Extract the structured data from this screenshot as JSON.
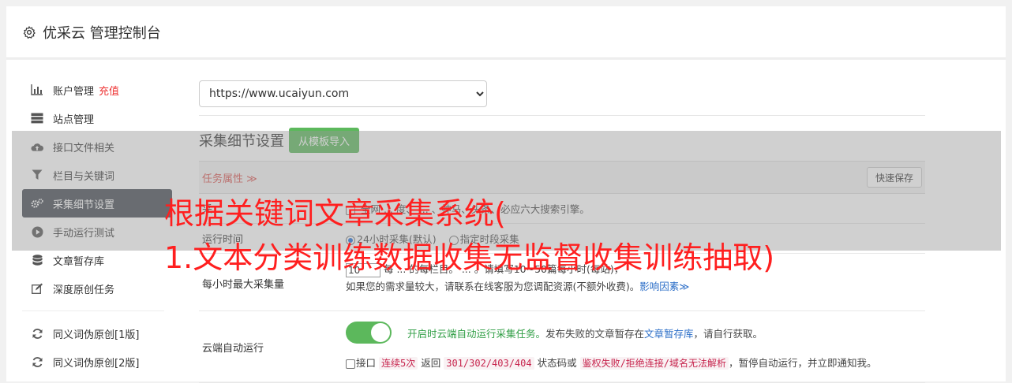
{
  "header": {
    "title": "优采云 管理控制台",
    "icon": "gear-icon"
  },
  "sidebar": {
    "items": [
      {
        "label": "账户管理",
        "badge": "充值",
        "icon": "bar-chart-icon"
      },
      {
        "label": "站点管理",
        "icon": "server-icon"
      },
      {
        "label": "接口文件相关",
        "icon": "cloud-upload-icon"
      },
      {
        "label": "栏目与关键词",
        "icon": "filter-icon"
      },
      {
        "label": "采集细节设置",
        "icon": "gears-icon",
        "active": true
      },
      {
        "label": "手动运行测试",
        "icon": "play-icon"
      },
      {
        "label": "文章暂存库",
        "icon": "database-icon"
      },
      {
        "label": "深度原创任务",
        "icon": "edit-icon"
      },
      {
        "label": "同义词伪原创[1版]",
        "icon": "refresh-icon"
      },
      {
        "label": "同义词伪原创[2版]",
        "icon": "refresh-icon"
      }
    ]
  },
  "site_select": {
    "value": "https://www.ucaiyun.com"
  },
  "section": {
    "title": "采集细节设置",
    "import_button": "从模板导入"
  },
  "panel": {
    "task_label": "任务属性 ≫",
    "save_button": "快速保存",
    "source_row": {
      "label": "采",
      "text": "全网  ...  度、  ...  、神马、头条、必应六大搜索引擎。"
    },
    "runtime_row": {
      "label": "运行时间",
      "option1": "24小时采集(默认)",
      "option2": "指定时段采集"
    },
    "max_row": {
      "label": "每小时最大采集量",
      "value": "10",
      "text1": "每  ...  的每栏目。  ...  。请填写10~50篇每小时(每站)，",
      "text2": "如果您的需求量较大，请联系在线客服为您调配资源(不额外收费)。",
      "link": "影响因素≫"
    },
    "cloud_row": {
      "label": "云端自动运行",
      "green_text": "开启时云端自动运行采集任务。",
      "text1": "发布失败的文章暂存在",
      "link": "文章暂存库",
      "text2": "，请自行获取。",
      "opt_prefix": "接口",
      "code1": "连续5次",
      "t1": "返回",
      "code2": "301/302/403/404",
      "t2": "状态码或",
      "code3": "鉴权失败/拒绝连接/域名无法解析",
      "t3": "，暂停自动运行，并立即通知我。"
    }
  },
  "watermark": {
    "line1": "根据关键词文章采集系统(",
    "line2": "1.文本分类训练数据收集无监督收集训练抽取)"
  },
  "colors": {
    "active_bg": "#444a53",
    "green": "#5cb85c",
    "red_text": "#ff1f1f",
    "link": "#2a6dc7"
  }
}
